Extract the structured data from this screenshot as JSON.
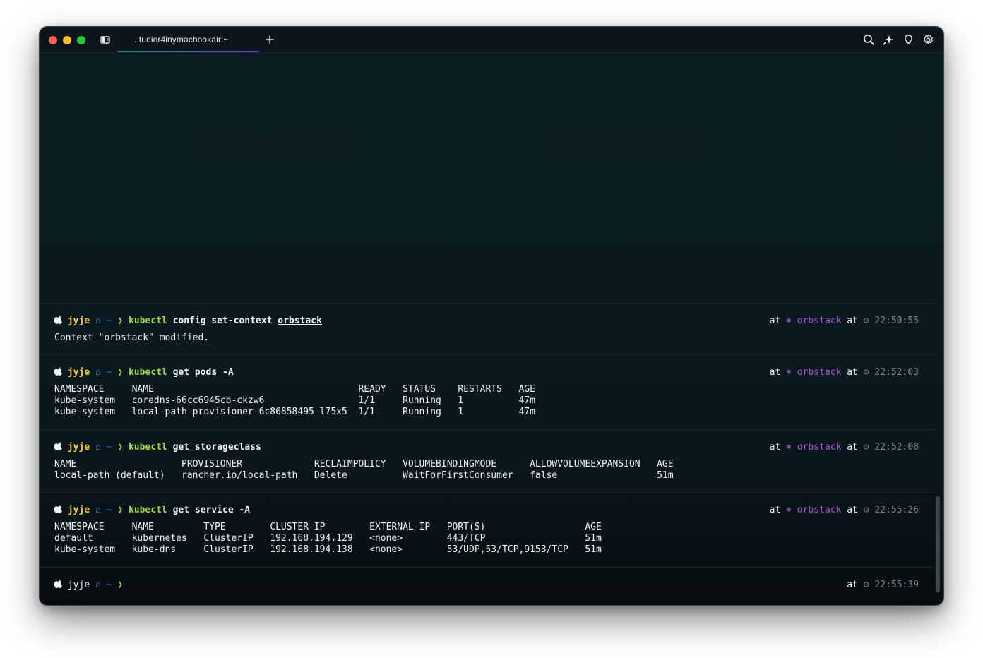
{
  "window": {
    "tab_title": "..tudior4inymacbookair:~",
    "new_tab_label": "+"
  },
  "prompt": {
    "user": "jyje",
    "home": "~",
    "arrow": "❯",
    "at": "at",
    "context": "orbstack",
    "context_glyph": "⎈",
    "clock_glyph": "⊙"
  },
  "blocks": [
    {
      "cmd": "kubectl",
      "args": "config set-context",
      "arg_underlined": "orbstack",
      "time": "22:50:55",
      "output": [
        "Context \"orbstack\" modified."
      ]
    },
    {
      "cmd": "kubectl",
      "args": "get pods -A",
      "time": "22:52:03",
      "output": [
        "NAMESPACE     NAME                                     READY   STATUS    RESTARTS   AGE",
        "kube-system   coredns-66cc6945cb-ckzw6                 1/1     Running   1          47m",
        "kube-system   local-path-provisioner-6c86858495-l75x5  1/1     Running   1          47m"
      ]
    },
    {
      "cmd": "kubectl",
      "args": "get storageclass",
      "time": "22:52:08",
      "output": [
        "NAME                   PROVISIONER             RECLAIMPOLICY   VOLUMEBINDINGMODE      ALLOWVOLUMEEXPANSION   AGE",
        "local-path (default)   rancher.io/local-path   Delete          WaitForFirstConsumer   false                  51m"
      ]
    },
    {
      "cmd": "kubectl",
      "args": "get service -A",
      "time": "22:55:26",
      "output": [
        "NAMESPACE     NAME         TYPE        CLUSTER-IP        EXTERNAL-IP   PORT(S)                  AGE",
        "default       kubernetes   ClusterIP   192.168.194.129   <none>        443/TCP                  51m",
        "kube-system   kube-dns     ClusterIP   192.168.194.138   <none>        53/UDP,53/TCP,9153/TCP   51m"
      ]
    }
  ],
  "current_prompt": {
    "time": "22:55:39"
  },
  "colors": {
    "accent_yellow": "#f5c93a",
    "accent_green": "#9fd84a",
    "accent_purple": "#a856d8",
    "accent_blue": "#2e6fb0",
    "close": "#ff5f57",
    "minimize": "#febc2e",
    "zoom": "#28c840"
  },
  "icons": [
    "apple-icon",
    "home-icon",
    "kubernetes-icon",
    "clock-icon",
    "search-icon",
    "ai-sparkle-icon",
    "lightbulb-icon",
    "settings-gear-icon",
    "sidebar-toggle-icon",
    "plus-icon"
  ]
}
